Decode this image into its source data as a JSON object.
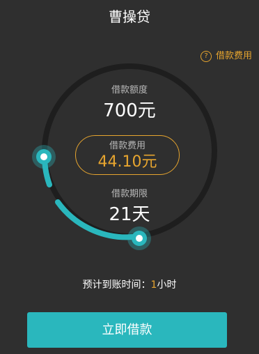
{
  "header": {
    "title": "曹操贷"
  },
  "fee_help": {
    "icon": "question-circle-icon",
    "label": "借款费用"
  },
  "amount": {
    "label": "借款额度",
    "value": "700元"
  },
  "fee": {
    "label": "借款费用",
    "value": "44.10元"
  },
  "term": {
    "label": "借款期限",
    "value": "21天"
  },
  "arrival": {
    "prefix": "预计到账时间：",
    "hours": "1",
    "suffix": "小时"
  },
  "submit": {
    "label": "立即借款"
  },
  "colors": {
    "background": "#2f2f2f",
    "accent_teal": "#2ab7bd",
    "accent_orange": "#e7a52f",
    "ring_track": "#1e1e1e"
  }
}
